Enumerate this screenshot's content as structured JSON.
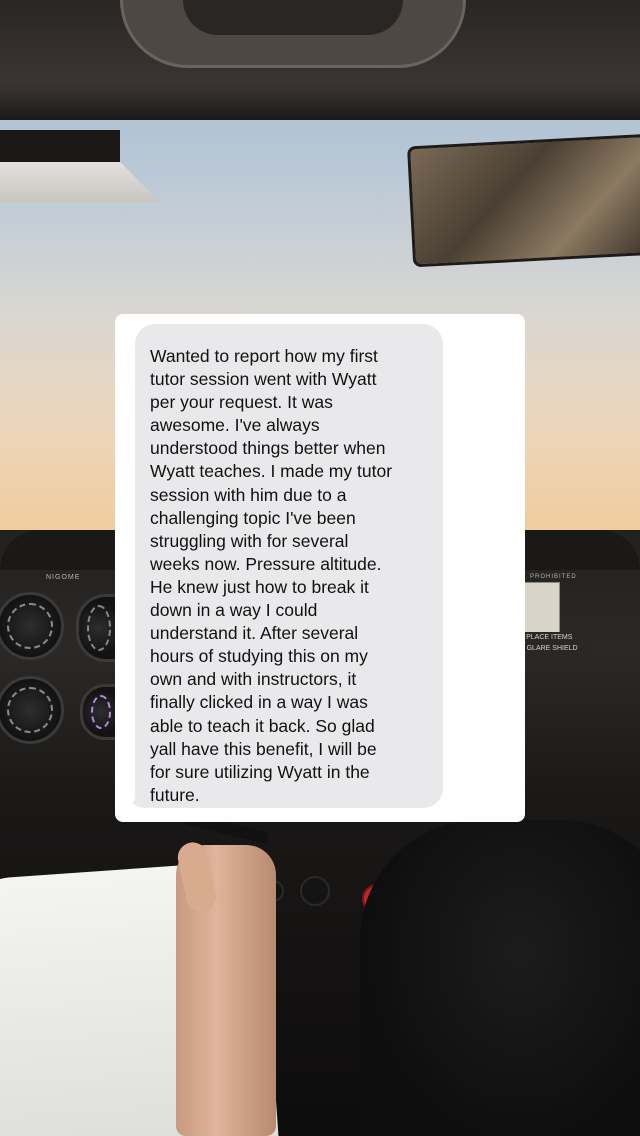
{
  "message": {
    "text": "Wanted to report how my first\ntutor session went with Wyatt\nper your request. It was\nawesome. I've always\nunderstood things better when\nWyatt teaches. I made my tutor\nsession with him due to a\nchallenging topic I've been\nstruggling with for several\nweeks now. Pressure altitude.\nHe knew just how to break it\ndown in a way I could\nunderstand it. After several\nhours of studying this on my\nown and with instructors, it\nfinally clicked in a way I was\nable to teach it back. So glad\nyall have this benefit, I will be\nfor sure utilizing Wyatt in the\nfuture."
  },
  "background": {
    "panel_label": "NIGOME",
    "placard_text": "T PLACE ITEMS\nE GLARE SHIELD",
    "prohibited_label": "PROHIBITED"
  }
}
